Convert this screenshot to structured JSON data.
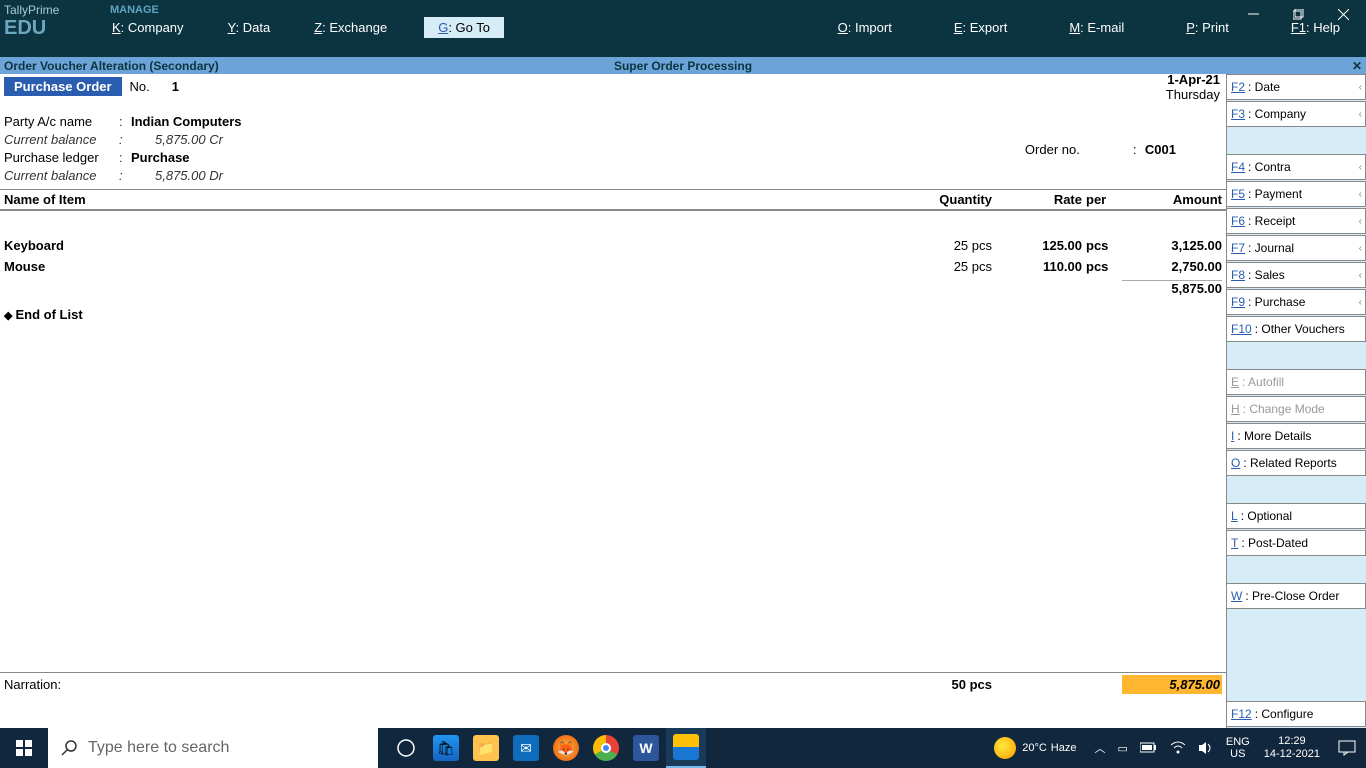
{
  "app": {
    "title": "TallyPrime",
    "edition": "EDU",
    "manage": "MANAGE"
  },
  "menu": {
    "k": "K",
    "k_label": ": Company",
    "y": "Y",
    "y_label": ": Data",
    "z": "Z",
    "z_label": ": Exchange",
    "g": "G",
    "g_label": ": Go To",
    "o": "O",
    "o_label": ": Import",
    "e": "E",
    "e_label": ": Export",
    "m": "M",
    "m_label": ": E-mail",
    "p": "P",
    "p_label": ": Print",
    "f1": "F1",
    "f1_label": ": Help"
  },
  "secbar": {
    "left": "Order Voucher Alteration (Secondary)",
    "center": "Super Order Processing"
  },
  "voucher": {
    "type": "Purchase Order",
    "no_label": "No.",
    "no_val": "1",
    "date": "1-Apr-21",
    "day": "Thursday",
    "party_label": "Party A/c name",
    "party_val": "Indian Computers",
    "curbal_label": "Current balance",
    "curbal_val": "5,875.00 Cr",
    "ledger_label": "Purchase ledger",
    "ledger_val": "Purchase",
    "ledgerbal_val": "5,875.00 Dr",
    "order_label": "Order no.",
    "order_val": "C001"
  },
  "cols": {
    "name": "Name of Item",
    "qty": "Quantity",
    "rate": "Rate",
    "per": "per",
    "amount": "Amount"
  },
  "items": [
    {
      "name": "Keyboard",
      "qty": "25 pcs",
      "rate": "125.00",
      "per": "pcs",
      "amount": "3,125.00"
    },
    {
      "name": "Mouse",
      "qty": "25 pcs",
      "rate": "110.00",
      "per": "pcs",
      "amount": "2,750.00"
    }
  ],
  "subtotal": "5,875.00",
  "endoflist": "End of List",
  "footer": {
    "narration": "Narration:",
    "total_qty": "50 pcs",
    "total_amount": "5,875.00"
  },
  "side": {
    "f2": "F2",
    "f2_l": ": Date",
    "f3": "F3",
    "f3_l": ": Company",
    "f4": "F4",
    "f4_l": ": Contra",
    "f5": "F5",
    "f5_l": ": Payment",
    "f6": "F6",
    "f6_l": ": Receipt",
    "f7": "F7",
    "f7_l": ": Journal",
    "f8": "F8",
    "f8_l": ": Sales",
    "f9": "F9",
    "f9_l": ": Purchase",
    "f10": "F10",
    "f10_l": ": Other Vouchers",
    "e": "E",
    "e_l": ": Autofill",
    "h": "H",
    "h_l": ": Change Mode",
    "i": "I",
    "i_l": ": More Details",
    "o": "O",
    "o_l": ": Related Reports",
    "l": "L",
    "l_l": ": Optional",
    "t": "T",
    "t_l": ": Post-Dated",
    "w": "W",
    "w_l": ": Pre-Close Order",
    "f12": "F12",
    "f12_l": ": Configure"
  },
  "taskbar": {
    "search_placeholder": "Type here to search",
    "weather_temp": "20°C",
    "weather_cond": "Haze",
    "lang1": "ENG",
    "lang2": "US",
    "time": "12:29",
    "date": "14-12-2021"
  }
}
